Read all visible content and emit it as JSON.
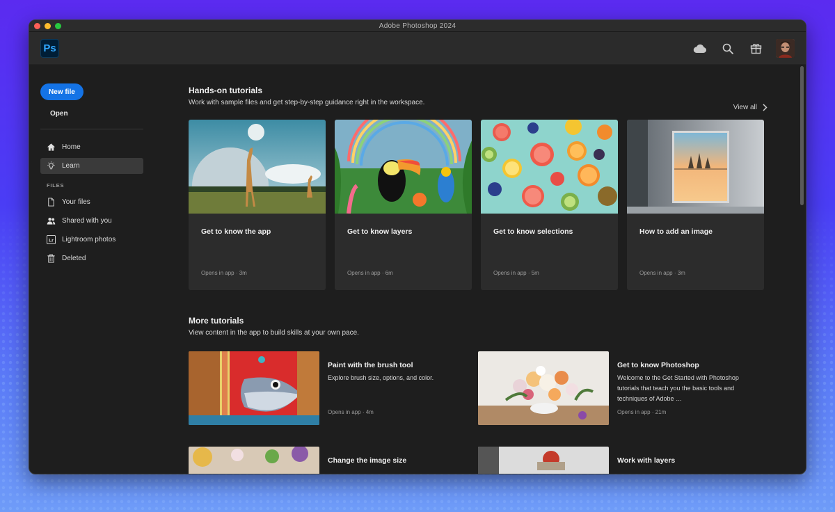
{
  "window": {
    "title": "Adobe Photoshop 2024"
  },
  "appbar": {
    "logo_text": "Ps",
    "icons": [
      "cloud-icon",
      "search-icon",
      "gift-icon"
    ]
  },
  "sidebar": {
    "new_file": "New file",
    "open": "Open",
    "nav": [
      {
        "label": "Home",
        "icon": "home-icon"
      },
      {
        "label": "Learn",
        "icon": "lightbulb-icon",
        "active": true
      }
    ],
    "files_heading": "FILES",
    "files": [
      {
        "label": "Your files",
        "icon": "file-icon"
      },
      {
        "label": "Shared with you",
        "icon": "shared-users-icon"
      },
      {
        "label": "Lightroom photos",
        "icon": "lightroom-icon",
        "icon_text": "Lr"
      },
      {
        "label": "Deleted",
        "icon": "trash-icon"
      }
    ]
  },
  "hands_on": {
    "title": "Hands-on tutorials",
    "subtitle": "Work with sample files and get step-by-step guidance right in the workspace.",
    "view_all": "View all",
    "cards": [
      {
        "title": "Get to know the app",
        "meta": "Opens in app  ·  3m"
      },
      {
        "title": "Get to know layers",
        "meta": "Opens in app  ·  6m"
      },
      {
        "title": "Get to know selections",
        "meta": "Opens in app  ·  5m"
      },
      {
        "title": "How to add an image",
        "meta": "Opens in app  ·  3m"
      }
    ]
  },
  "more": {
    "title": "More tutorials",
    "subtitle": "View content in the app to build skills at your own pace.",
    "items": [
      {
        "title": "Paint with the brush tool",
        "desc": "Explore brush size, options, and color.",
        "meta": "Opens in app  ·  4m"
      },
      {
        "title": "Get to know Photoshop",
        "desc": "Welcome to the Get Started with Photoshop tutorials that teach you the basic tools and techniques of Adobe …",
        "meta": "Opens in app  ·  21m"
      },
      {
        "title": "Change the image size",
        "desc": "",
        "meta": ""
      },
      {
        "title": "Work with layers",
        "desc": "",
        "meta": ""
      }
    ]
  }
}
